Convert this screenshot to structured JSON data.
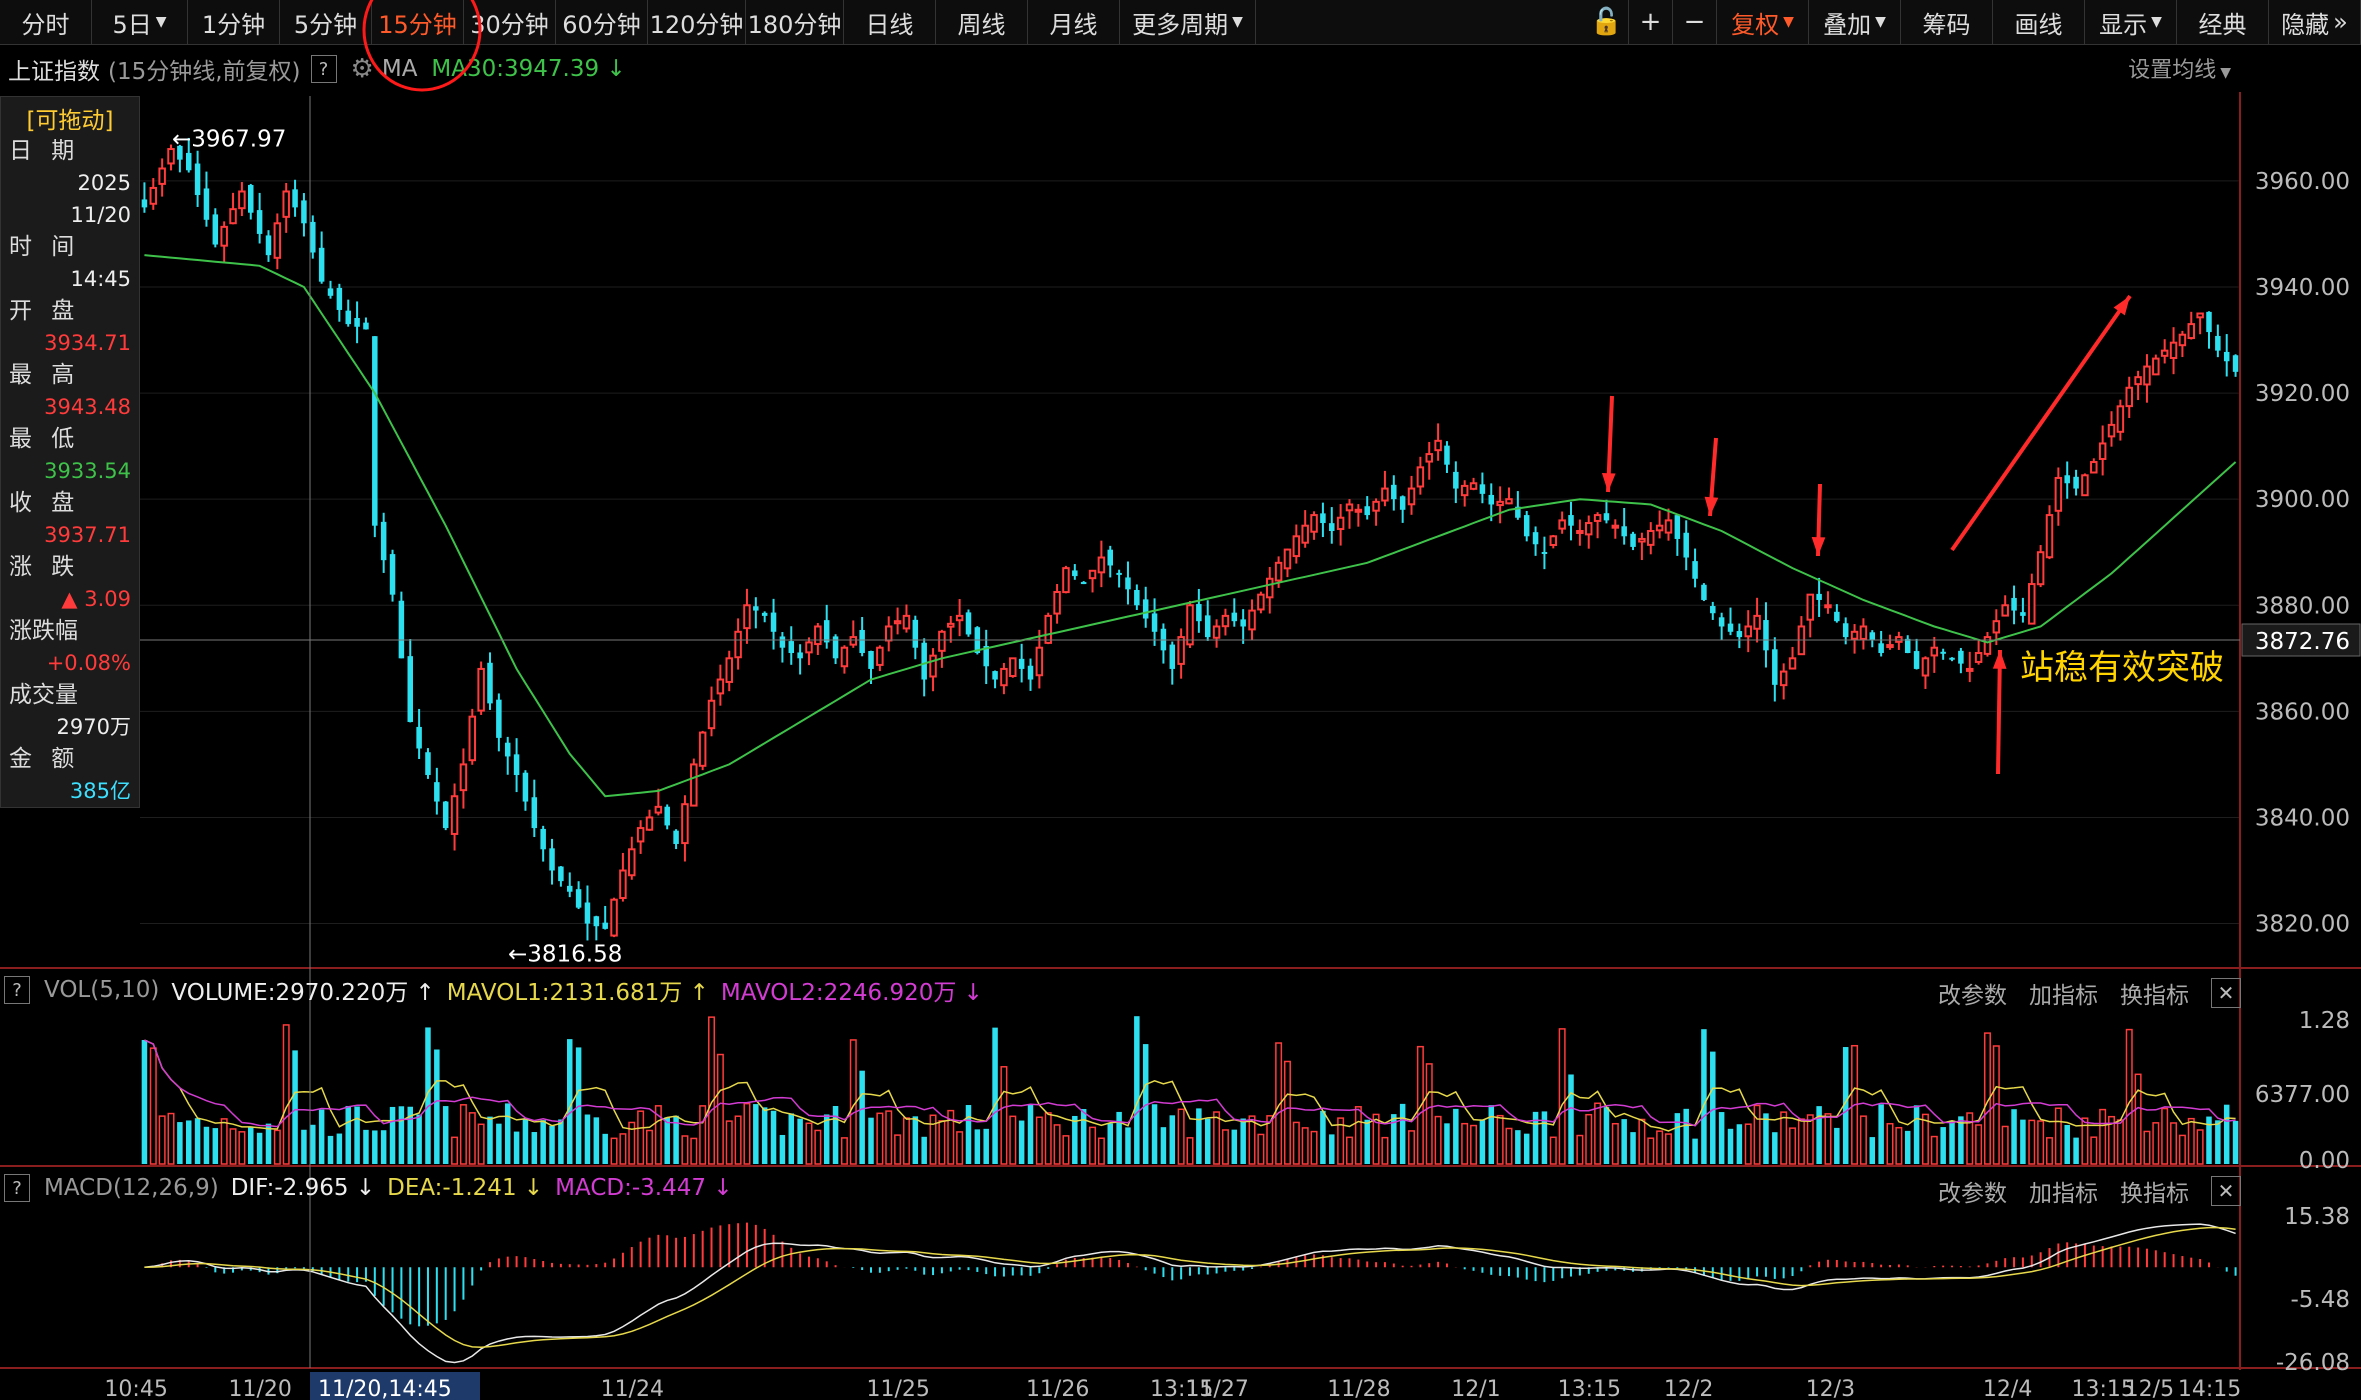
{
  "toolbar": {
    "left_items": [
      "分时",
      "5日",
      "1分钟",
      "5分钟",
      "15分钟",
      "30分钟",
      "60分钟",
      "120分钟",
      "180分钟",
      "日线",
      "周线",
      "月线",
      "更多周期"
    ],
    "active_index": 4,
    "right_items": [
      "复权",
      "叠加",
      "筹码",
      "画线",
      "显示",
      "经典",
      "隐藏"
    ],
    "lock": "lock-icon",
    "plus": "+",
    "minus": "−"
  },
  "header": {
    "title": "上证指数",
    "subtitle": "(15分钟线,前复权)",
    "help": "?",
    "ma_label": "MA",
    "ma30_text": "MA30:3947.39 ↓",
    "set_ma": "设置均线"
  },
  "panel": {
    "drag": "[可拖动]",
    "rows": [
      {
        "label": "日 期",
        "value": "2025",
        "value2": "11/20",
        "color": "wht"
      },
      {
        "label": "时 间",
        "value": "14:45",
        "color": "wht"
      },
      {
        "label": "开 盘",
        "value": "3934.71",
        "color": "red"
      },
      {
        "label": "最 高",
        "value": "3943.48",
        "color": "red"
      },
      {
        "label": "最 低",
        "value": "3933.54",
        "color": "grn"
      },
      {
        "label": "收 盘",
        "value": "3937.71",
        "color": "red"
      },
      {
        "label": "涨 跌",
        "value": "▲ 3.09",
        "color": "red"
      },
      {
        "label": "涨跌幅",
        "value": "+0.08%",
        "color": "red"
      },
      {
        "label": "成交量",
        "value": "2970万",
        "color": "wht"
      },
      {
        "label": "金 额",
        "value": "385亿",
        "color": "cyn"
      }
    ]
  },
  "vol_header": {
    "name": "VOL(5,10)",
    "volume": "VOLUME:2970.220万 ↑",
    "mavol1": "MAVOL1:2131.681万 ↑",
    "mavol2": "MAVOL2:2246.920万 ↓"
  },
  "macd_header": {
    "name": "MACD(12,26,9)",
    "dif": "DIF:-2.965 ↓",
    "dea": "DEA:-1.241 ↓",
    "macd": "MACD:-3.447 ↓"
  },
  "sub_tools": [
    "改参数",
    "加指标",
    "换指标"
  ],
  "annotation": "站稳有效突破",
  "crosshair_price": "3872.76",
  "crosshair_time": "11/20,14:45",
  "price_marks": {
    "high": "3967.97",
    "low": "3816.58"
  },
  "colors": {
    "up": "#ff3b3b",
    "down": "#2de0f0",
    "ma30": "#3ec24a",
    "mavol1": "#e6d84a",
    "mavol2": "#d23cd2",
    "dif": "#e8e8e8",
    "dea": "#e6d84a",
    "annot_arrow": "#ff2a2a",
    "active_tab": "#ff5a2a"
  },
  "chart_data": {
    "type": "candlestick",
    "price_axis": {
      "ticks": [
        3960,
        3940,
        3920,
        3900,
        3880,
        3860,
        3840,
        3820
      ],
      "range": [
        3812,
        3976
      ]
    },
    "x_labels": [
      "10:45",
      "11/20",
      "11/24",
      "11/25",
      "11/26",
      "13:15",
      "11/27",
      "11/28",
      "12/1",
      "13:15",
      "12/2",
      "12/3",
      "12/4",
      "13:15",
      "12/5",
      "14:15"
    ],
    "volume_axis": {
      "ticks": [
        "1.28",
        "6377.00",
        "0.00"
      ]
    },
    "macd_axis": {
      "ticks": [
        "15.38",
        "-5.48",
        "-26.08"
      ]
    },
    "anchors": [
      [
        0,
        3955
      ],
      [
        3,
        3966
      ],
      [
        5,
        3962
      ],
      [
        8,
        3948
      ],
      [
        11,
        3958
      ],
      [
        14,
        3946
      ],
      [
        16,
        3958
      ],
      [
        18,
        3952
      ],
      [
        20,
        3941
      ],
      [
        23,
        3933
      ],
      [
        25,
        3932
      ],
      [
        26,
        3895
      ],
      [
        28,
        3882
      ],
      [
        30,
        3858
      ],
      [
        32,
        3848
      ],
      [
        34,
        3838
      ],
      [
        36,
        3850
      ],
      [
        38,
        3868
      ],
      [
        40,
        3855
      ],
      [
        42,
        3848
      ],
      [
        44,
        3838
      ],
      [
        46,
        3830
      ],
      [
        48,
        3826
      ],
      [
        50,
        3820
      ],
      [
        52,
        3819
      ],
      [
        54,
        3830
      ],
      [
        56,
        3838
      ],
      [
        58,
        3842
      ],
      [
        60,
        3835
      ],
      [
        62,
        3850
      ],
      [
        64,
        3862
      ],
      [
        66,
        3870
      ],
      [
        68,
        3880
      ],
      [
        70,
        3878
      ],
      [
        72,
        3872
      ],
      [
        74,
        3870
      ],
      [
        76,
        3876
      ],
      [
        78,
        3870
      ],
      [
        80,
        3874
      ],
      [
        82,
        3868
      ],
      [
        84,
        3876
      ],
      [
        86,
        3878
      ],
      [
        88,
        3866
      ],
      [
        90,
        3875
      ],
      [
        92,
        3878
      ],
      [
        94,
        3871
      ],
      [
        96,
        3866
      ],
      [
        98,
        3870
      ],
      [
        100,
        3866
      ],
      [
        102,
        3878
      ],
      [
        104,
        3887
      ],
      [
        106,
        3884
      ],
      [
        108,
        3889
      ],
      [
        110,
        3886
      ],
      [
        112,
        3880
      ],
      [
        114,
        3875
      ],
      [
        116,
        3868
      ],
      [
        118,
        3880
      ],
      [
        120,
        3874
      ],
      [
        122,
        3878
      ],
      [
        124,
        3876
      ],
      [
        126,
        3882
      ],
      [
        128,
        3888
      ],
      [
        130,
        3893
      ],
      [
        132,
        3897
      ],
      [
        134,
        3894
      ],
      [
        136,
        3899
      ],
      [
        138,
        3897
      ],
      [
        140,
        3902
      ],
      [
        142,
        3898
      ],
      [
        144,
        3906
      ],
      [
        146,
        3911
      ],
      [
        148,
        3902
      ],
      [
        150,
        3903
      ],
      [
        152,
        3899
      ],
      [
        154,
        3900
      ],
      [
        156,
        3893
      ],
      [
        158,
        3890
      ],
      [
        160,
        3896
      ],
      [
        162,
        3894
      ],
      [
        164,
        3897
      ],
      [
        166,
        3895
      ],
      [
        168,
        3891
      ],
      [
        170,
        3894
      ],
      [
        172,
        3896
      ],
      [
        174,
        3889
      ],
      [
        176,
        3881
      ],
      [
        178,
        3876
      ],
      [
        180,
        3874
      ],
      [
        182,
        3878
      ],
      [
        184,
        3865
      ],
      [
        186,
        3870
      ],
      [
        188,
        3882
      ],
      [
        190,
        3880
      ],
      [
        192,
        3874
      ],
      [
        194,
        3876
      ],
      [
        196,
        3871
      ],
      [
        198,
        3874
      ],
      [
        200,
        3868
      ],
      [
        202,
        3872
      ],
      [
        204,
        3870
      ],
      [
        206,
        3868
      ],
      [
        208,
        3874
      ],
      [
        210,
        3880
      ],
      [
        212,
        3878
      ],
      [
        214,
        3890
      ],
      [
        216,
        3904
      ],
      [
        218,
        3902
      ],
      [
        220,
        3907
      ],
      [
        222,
        3914
      ],
      [
        224,
        3921
      ],
      [
        226,
        3925
      ],
      [
        228,
        3928
      ],
      [
        230,
        3931
      ],
      [
        232,
        3935
      ],
      [
        234,
        3928
      ],
      [
        236,
        3924
      ]
    ],
    "ma30_anchors": [
      [
        0,
        3946
      ],
      [
        13,
        3944
      ],
      [
        18,
        3940
      ],
      [
        26,
        3920
      ],
      [
        34,
        3895
      ],
      [
        42,
        3868
      ],
      [
        48,
        3852
      ],
      [
        52,
        3844
      ],
      [
        58,
        3845
      ],
      [
        66,
        3850
      ],
      [
        74,
        3858
      ],
      [
        82,
        3866
      ],
      [
        90,
        3870
      ],
      [
        98,
        3873
      ],
      [
        106,
        3876
      ],
      [
        114,
        3879
      ],
      [
        122,
        3882
      ],
      [
        130,
        3885
      ],
      [
        138,
        3888
      ],
      [
        146,
        3893
      ],
      [
        154,
        3898
      ],
      [
        162,
        3900
      ],
      [
        170,
        3899
      ],
      [
        178,
        3894
      ],
      [
        186,
        3887
      ],
      [
        194,
        3881
      ],
      [
        202,
        3876
      ],
      [
        208,
        3873
      ],
      [
        214,
        3876
      ],
      [
        222,
        3886
      ],
      [
        230,
        3898
      ],
      [
        236,
        3907
      ]
    ],
    "n": 237
  }
}
